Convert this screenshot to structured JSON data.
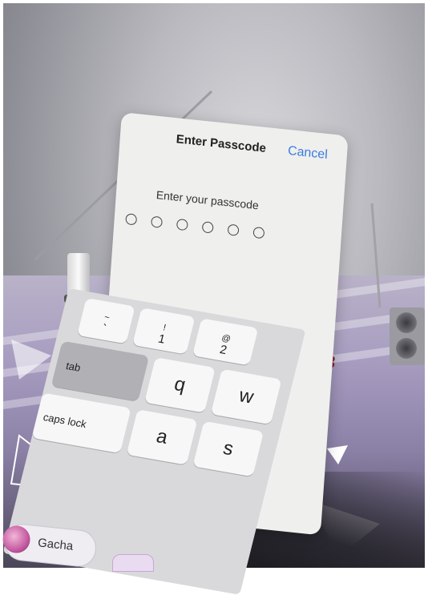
{
  "dialog": {
    "title": "Enter Passcode",
    "cancel_label": "Cancel",
    "prompt": "Enter your passcode",
    "passcode_length": 6
  },
  "keyboard": {
    "row1": [
      {
        "top": "~",
        "bottom": "`"
      },
      {
        "top": "!",
        "bottom": "1"
      },
      {
        "top": "@",
        "bottom": "2"
      }
    ],
    "tab_label": "tab",
    "row2_letters": [
      "q",
      "w"
    ],
    "caps_label": "caps lock",
    "row3_letters": [
      "a",
      "s"
    ]
  },
  "background_app": {
    "bottom_button_label": "Gacha"
  },
  "colors": {
    "accent": "#3b7be0",
    "dialog_bg": "#efefed"
  },
  "icons": [
    "gacha-icon",
    "speaker-icon",
    "bow-icon",
    "lamp-icon"
  ]
}
